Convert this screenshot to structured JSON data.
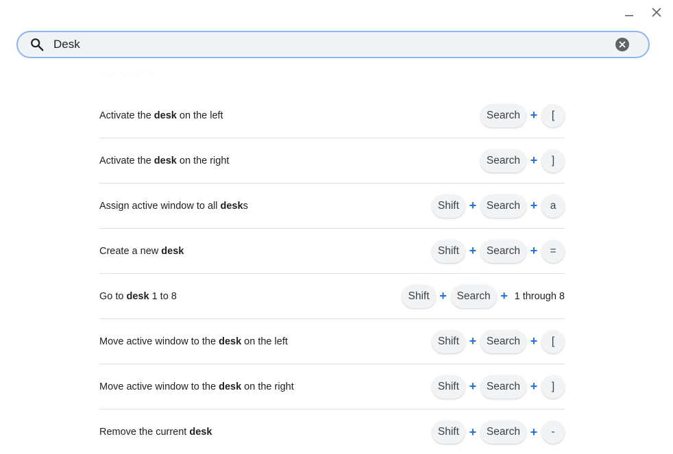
{
  "search": {
    "value": "Desk",
    "placeholder": ""
  },
  "header_hint": "· · · · · · · ·",
  "plus_symbol": "+",
  "rows": [
    {
      "pre": "Activate the ",
      "match": "desk",
      "post": " on the left",
      "keys": [
        "Search",
        "["
      ],
      "tail": ""
    },
    {
      "pre": "Activate the ",
      "match": "desk",
      "post": " on the right",
      "keys": [
        "Search",
        "]"
      ],
      "tail": ""
    },
    {
      "pre": "Assign active window to all ",
      "match": "desk",
      "post": "s",
      "keys": [
        "Shift",
        "Search",
        "a"
      ],
      "tail": ""
    },
    {
      "pre": "Create a new ",
      "match": "desk",
      "post": "",
      "keys": [
        "Shift",
        "Search",
        "="
      ],
      "tail": ""
    },
    {
      "pre": "Go to ",
      "match": "desk",
      "post": " 1 to 8",
      "keys": [
        "Shift",
        "Search"
      ],
      "tail": "1 through 8"
    },
    {
      "pre": "Move active window to the ",
      "match": "desk",
      "post": " on the left",
      "keys": [
        "Shift",
        "Search",
        "["
      ],
      "tail": ""
    },
    {
      "pre": "Move active window to the ",
      "match": "desk",
      "post": " on the right",
      "keys": [
        "Shift",
        "Search",
        "]"
      ],
      "tail": ""
    },
    {
      "pre": "Remove the current ",
      "match": "desk",
      "post": "",
      "keys": [
        "Shift",
        "Search",
        "-"
      ],
      "tail": ""
    }
  ],
  "colors": {
    "accent": "#1a73e8",
    "search_border": "#8ab4f8",
    "key_bg": "#f1f3f4"
  }
}
